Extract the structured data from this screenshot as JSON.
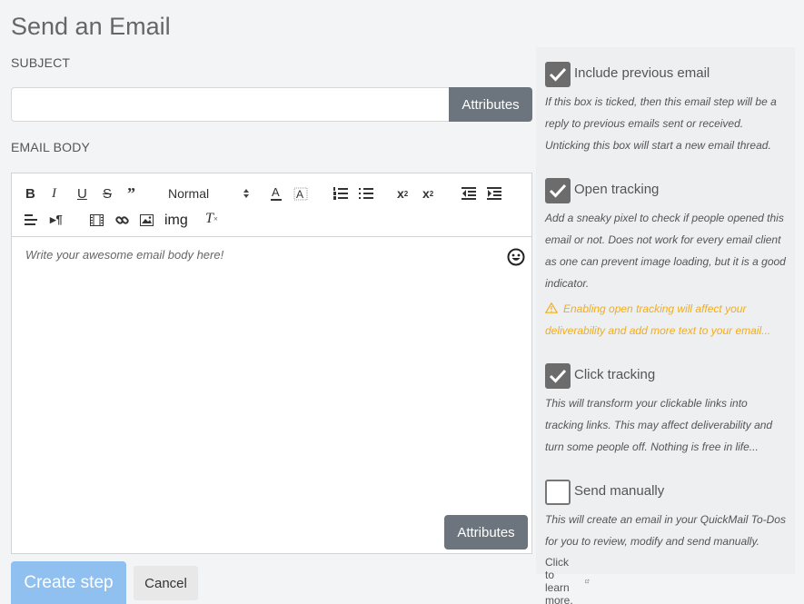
{
  "page": {
    "title": "Send an Email"
  },
  "subject": {
    "label": "SUBJECT",
    "value": "",
    "placeholder": "",
    "attributes_label": "Attributes"
  },
  "email_body": {
    "label": "EMAIL BODY",
    "format_select": "Normal",
    "image_button": "img",
    "placeholder": "Write your awesome email body here!",
    "attributes_label": "Attributes"
  },
  "actions": {
    "create_label": "Create step",
    "cancel_label": "Cancel"
  },
  "options": {
    "include_previous": {
      "title": "Include previous email",
      "checked": true,
      "desc": "If this box is ticked, then this email step will be a reply to previous emails sent or received. Unticking this box will start a new email thread."
    },
    "open_tracking": {
      "title": "Open tracking",
      "checked": true,
      "desc": "Add a sneaky pixel to check if people opened this email or not. Does not work for every email client as one can prevent image loading, but it is a good indicator.",
      "warning": "Enabling open tracking will affect your deliverability and add more text to your email..."
    },
    "click_tracking": {
      "title": "Click tracking",
      "checked": true,
      "desc": "This will transform your clickable links into tracking links. This may affect deliverability and turn some people off. Nothing is free in life..."
    },
    "send_manually": {
      "title": "Send manually",
      "checked": false,
      "desc": "This will create an email in your QuickMail To-Dos for you to review, modify and send manually.",
      "learn_more": "Click to learn more."
    }
  },
  "colors": {
    "checkbox": "#6c6c6c",
    "warning": "#f0ad1e",
    "primary": "#8fc0ef",
    "secondary": "#6c757d"
  }
}
